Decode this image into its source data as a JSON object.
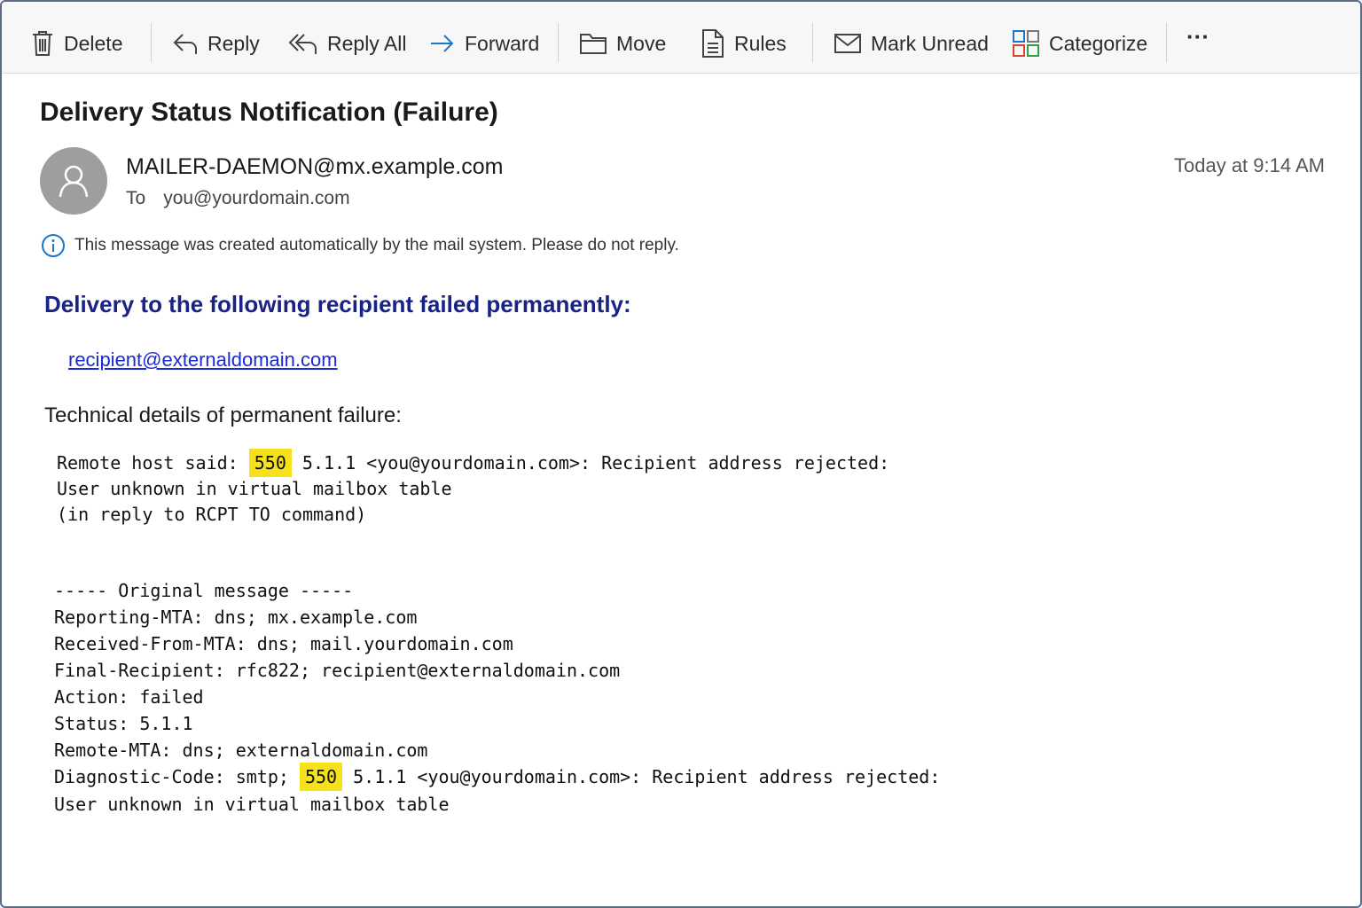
{
  "toolbar": {
    "delete": "Delete",
    "reply": "Reply",
    "reply_all": "Reply All",
    "forward": "Forward",
    "move": "Move",
    "rules": "Rules",
    "mark_unread": "Mark Unread",
    "categorize": "Categorize",
    "more": "···"
  },
  "message": {
    "subject": "Delivery Status Notification (Failure)",
    "from": "MAILER-DAEMON@mx.example.com",
    "to_label": "To",
    "to": "you@yourdomain.com",
    "date": "Today at 9:14 AM",
    "notice": "This message was created automatically by the mail system. Please do not reply."
  },
  "body": {
    "failed_heading": "Delivery to the following recipient failed permanently:",
    "recipient": "recipient@externaldomain.com",
    "tech_heading": "Technical details of permanent failure:",
    "remote_prefix": "Remote host said: ",
    "remote_code": "550",
    "remote_suffix": " 5.1.1 <you@yourdomain.com>: Recipient address rejected:",
    "remote_line2": "User unknown in virtual mailbox table",
    "remote_line3": "(in reply to RCPT TO command)",
    "orig_header": "----- Original message -----",
    "reporting_mta": "Reporting-MTA: dns; mx.example.com",
    "received_from": "Received-From-MTA: dns; mail.yourdomain.com",
    "final_recipient": "Final-Recipient: rfc822; recipient@externaldomain.com",
    "action": "Action: failed",
    "status": "Status: 5.1.1",
    "remote_mta": "Remote-MTA: dns; externaldomain.com",
    "diag_prefix": "Diagnostic-Code: smtp; ",
    "diag_code": "550",
    "diag_suffix": " 5.1.1 <you@yourdomain.com>: Recipient address rejected:",
    "diag_line2": "User unknown in virtual mailbox table"
  },
  "colors": {
    "heading_blue": "#1a2385",
    "link_blue": "#1a2bd0",
    "highlight": "#f6e21b",
    "info_blue": "#1b76c8"
  }
}
